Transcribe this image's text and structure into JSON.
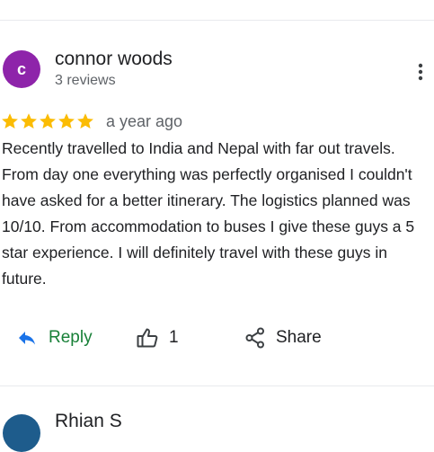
{
  "review": {
    "avatar_initial": "c",
    "reviewer_name": "connor woods",
    "reviewer_meta": "3 reviews",
    "rating": 5,
    "rating_max": 5,
    "date": "a year ago",
    "text": "Recently travelled to India and Nepal with far out travels. From day one everything was perfectly organised I couldn't have asked for a better itinerary. The logistics planned was 10/10. From accommodation to buses I give these guys a 5 star experience. I will definitely travel with these guys in future.",
    "actions": {
      "reply_label": "Reply",
      "like_count": "1",
      "share_label": "Share"
    }
  },
  "next_review": {
    "reviewer_name": "Rhian S"
  },
  "colors": {
    "avatar": "#8e24aa",
    "star": "#fbbc04",
    "reply_icon": "#1a73e8",
    "reply_text": "#188038",
    "secondary_text": "#5f6368",
    "divider": "#e8eaed"
  },
  "icons": {
    "more": "more-vert-icon",
    "star": "star-icon",
    "reply": "reply-icon",
    "like": "thumbs-up-icon",
    "share": "share-icon"
  }
}
